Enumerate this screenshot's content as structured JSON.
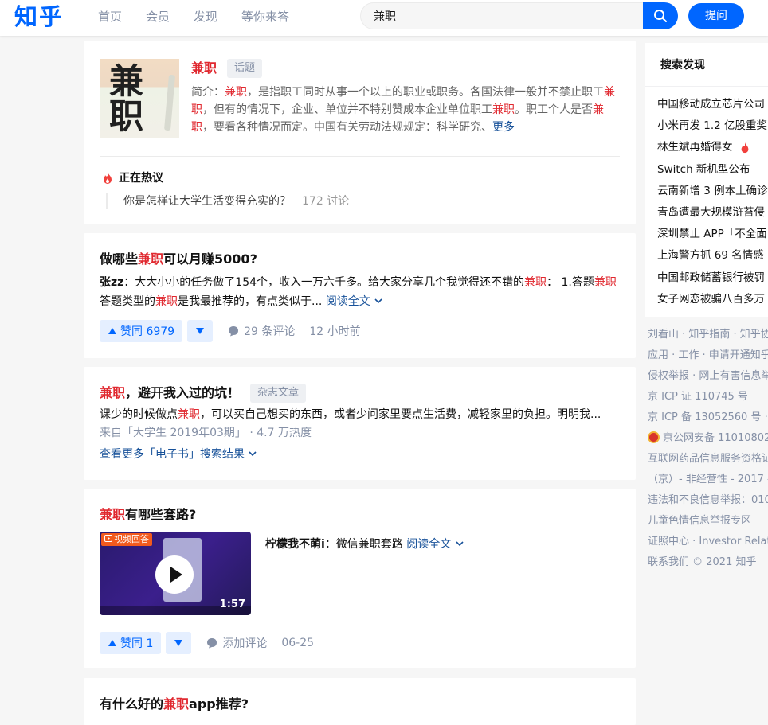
{
  "header": {
    "logo": "知乎",
    "nav": [
      "首页",
      "会员",
      "发现",
      "等你来答"
    ],
    "search_value": "兼职",
    "ask_label": "提问"
  },
  "topic": {
    "image_text": [
      "兼",
      "职"
    ],
    "title": "兼职",
    "tag": "话题",
    "desc_parts": [
      {
        "t": "简介：",
        "h": false
      },
      {
        "t": "兼职",
        "h": true
      },
      {
        "t": "，是指职工同时从事一个以上的职业或职务。各国法律一般并不禁止职工",
        "h": false
      },
      {
        "t": "兼职",
        "h": true
      },
      {
        "t": "，但有的情况下，企业、单位并不特别赞成本企业单位职工",
        "h": false
      },
      {
        "t": "兼职",
        "h": true
      },
      {
        "t": "。职工个人是否",
        "h": false
      },
      {
        "t": "兼职",
        "h": true
      },
      {
        "t": "，要看各种情况而定。中国有关劳动法规规定：科学研究、",
        "h": false
      }
    ],
    "more": "更多",
    "hot_label": "正在热议",
    "hot_question": "你是怎样让大学生活变得充实的？",
    "hot_count": "172 讨论"
  },
  "answer1": {
    "title_parts": [
      {
        "t": "做哪些",
        "h": false
      },
      {
        "t": "兼职",
        "h": true
      },
      {
        "t": "可以月赚5000?",
        "h": false
      }
    ],
    "author": "张zz",
    "excerpt_parts": [
      {
        "t": "：大大小小的任务做了154个，收入一万六千多。给大家分享几个我觉得还不错的",
        "h": false
      },
      {
        "t": "兼职",
        "h": true
      },
      {
        "t": "： 1.答题",
        "h": false
      },
      {
        "t": "兼职",
        "h": true
      },
      {
        "t": " 答题类型的",
        "h": false
      },
      {
        "t": "兼职",
        "h": true
      },
      {
        "t": "是我最推荐的，有点类似于... ",
        "h": false
      }
    ],
    "read_all": "阅读全文",
    "votes": "赞同 6979",
    "comments": "29 条评论",
    "time": "12 小时前"
  },
  "article": {
    "title_parts": [
      {
        "t": "兼职",
        "h": true
      },
      {
        "t": "，避开我入过的坑！",
        "h": false
      }
    ],
    "tag": "杂志文章",
    "excerpt_parts": [
      {
        "t": "课少的时候做点",
        "h": false
      },
      {
        "t": "兼职",
        "h": true
      },
      {
        "t": "，可以买自己想买的东西，或者少问家里要点生活费，减轻家里的负担。明明我...",
        "h": false
      }
    ],
    "source": "来自「大学生 2019年03期」 · 4.7 万热度",
    "more_link": "查看更多「电子书」搜索结果"
  },
  "answer2": {
    "title_parts": [
      {
        "t": "兼职",
        "h": true
      },
      {
        "t": "有哪些套路?",
        "h": false
      }
    ],
    "video_badge": "视频回答",
    "video_duration": "1:57",
    "author": "柠檬我不萌i",
    "excerpt": "：微信兼职套路 ",
    "read_all": "阅读全文",
    "votes": "赞同 1",
    "comments": "添加评论",
    "time": "06-25"
  },
  "answer3": {
    "title_parts": [
      {
        "t": "有什么好的",
        "h": false
      },
      {
        "t": "兼职",
        "h": true
      },
      {
        "t": "app推荐?",
        "h": false
      }
    ]
  },
  "sidebar": {
    "title": "搜索发现",
    "items": [
      "中国移动成立芯片公司",
      "小米再发 1.2 亿股重奖",
      "林生斌再婚得女",
      "Switch 新机型公布",
      "云南新增 3 例本土确诊",
      "青岛遭最大规模浒苔侵",
      "深圳禁止 APP「不全面",
      "上海警方抓 69 名情感",
      "中国邮政储蓄银行被罚",
      "女子网恋被骗八百多万"
    ],
    "hot_item_index": 2
  },
  "footer": [
    "刘看山 · 知乎指南 · 知乎协",
    "应用 · 工作 · 申请开通知乎",
    "侵权举报 · 网上有害信息举",
    "京 ICP 证 110745 号",
    "京 ICP 备 13052560 号 ·",
    "京公网安备 11010802",
    "互联网药品信息服务资格证",
    "（京）- 非经营性 - 2017 -",
    "违法和不良信息举报：010",
    "儿童色情信息举报专区",
    "证照中心 · Investor Relat",
    "联系我们 © 2021 知乎"
  ],
  "colors": {
    "brand": "#0066ff",
    "highlight": "#e0282f",
    "meta": "#8590a6"
  }
}
